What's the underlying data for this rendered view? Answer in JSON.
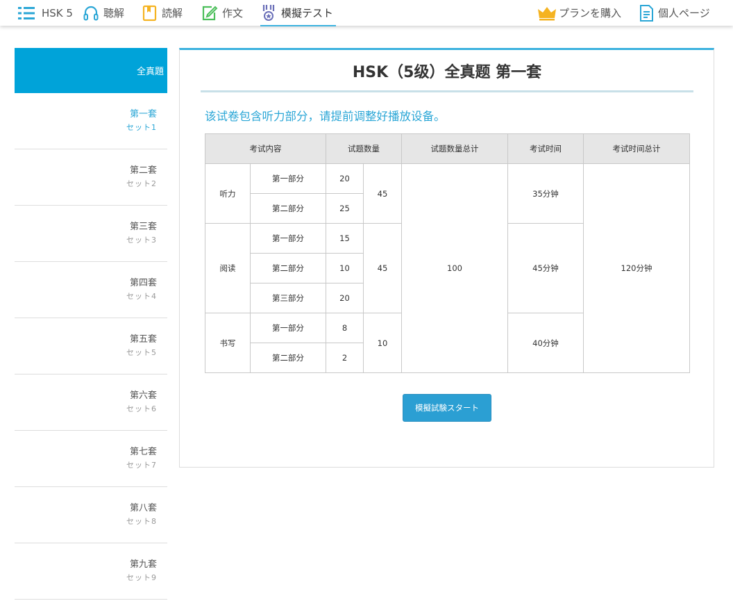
{
  "nav": {
    "logo": "HSK 5",
    "items": [
      {
        "label": "聴解",
        "icon": "headphones-icon",
        "color": "#2aa6d6"
      },
      {
        "label": "読解",
        "icon": "book-icon",
        "color": "#f5b321"
      },
      {
        "label": "作文",
        "icon": "edit-icon",
        "color": "#4cbf5b"
      },
      {
        "label": "模擬テスト",
        "icon": "medal-icon",
        "color": "#6a6fb8",
        "active": true
      }
    ],
    "plan": {
      "label": "プランを購入",
      "icon": "crown-icon",
      "color": "#f5b321"
    },
    "mypage": {
      "label": "個人ページ",
      "icon": "document-icon",
      "color": "#2aa6d6"
    }
  },
  "sidebar": {
    "header": "全真題",
    "items": [
      {
        "zh": "第一套",
        "jp": "セット1",
        "active": true
      },
      {
        "zh": "第二套",
        "jp": "セット2"
      },
      {
        "zh": "第三套",
        "jp": "セット3"
      },
      {
        "zh": "第四套",
        "jp": "セット4"
      },
      {
        "zh": "第五套",
        "jp": "セット5"
      },
      {
        "zh": "第六套",
        "jp": "セット6"
      },
      {
        "zh": "第七套",
        "jp": "セット7"
      },
      {
        "zh": "第八套",
        "jp": "セット8"
      },
      {
        "zh": "第九套",
        "jp": "セット9"
      }
    ]
  },
  "main": {
    "title": "HSK（5级）全真题 第一套",
    "notice": "该试卷包含听力部分，请提前调整好播放设备。",
    "table": {
      "headers": [
        "考试内容",
        "试题数量",
        "试题数量总计",
        "考试时间",
        "考试时间总计"
      ],
      "sections": [
        {
          "name": "听力",
          "parts": [
            {
              "part": "第一部分",
              "count": "20"
            },
            {
              "part": "第二部分",
              "count": "25"
            }
          ],
          "subtotal": "45",
          "time": "35分钟"
        },
        {
          "name": "阅读",
          "parts": [
            {
              "part": "第一部分",
              "count": "15"
            },
            {
              "part": "第二部分",
              "count": "10"
            },
            {
              "part": "第三部分",
              "count": "20"
            }
          ],
          "subtotal": "45",
          "time": "45分钟"
        },
        {
          "name": "书写",
          "parts": [
            {
              "part": "第一部分",
              "count": "8"
            },
            {
              "part": "第二部分",
              "count": "2"
            }
          ],
          "subtotal": "10",
          "time": "40分钟"
        }
      ],
      "total_count": "100",
      "total_time": "120分钟"
    },
    "start_button": "模擬試験スタート"
  },
  "colors": {
    "accent": "#00a3d9",
    "button": "#2b9fd3",
    "notice": "#2aa6d6"
  }
}
